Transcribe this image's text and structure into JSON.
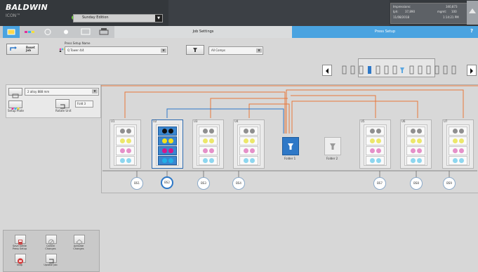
{
  "top": {
    "brand": "BALDWIN",
    "brand_sub": "ICON™",
    "edition": "Sunday Edition",
    "stats": {
      "impressions_label": "Impressions:",
      "impressions_value": "340,873",
      "iph_label": "Iph:",
      "iph_value": "37,890",
      "mgmt_label": "mgmt:",
      "mgmt_value": "100",
      "date": "11/08/2018",
      "time": "1:14:21 PM"
    }
  },
  "tabs": {
    "job_settings": "Job Settings",
    "press_setup": "Press Setup",
    "help": "?"
  },
  "controls": {
    "reset_job": "Reset Job",
    "press_setup_name_label": "Press Setup Name",
    "press_setup_name": "Q Tower 4/4",
    "all_comps": "All Comps"
  },
  "left_panel": {
    "dropdown_value": "2 alloy 888 mm",
    "setup_plate_label": "Setup Plate",
    "rotate_unit_label": "Rotate Unit",
    "rotate_value": "Fold 3"
  },
  "units": [
    {
      "label": "U1",
      "node": "BS1"
    },
    {
      "label": "U2",
      "node": "BS2"
    },
    {
      "label": "U3",
      "node": "BS3"
    },
    {
      "label": "U4",
      "node": "BS4"
    },
    {
      "label": "U5",
      "node": "BS7"
    },
    {
      "label": "U6",
      "node": "BS8"
    },
    {
      "label": "U7",
      "node": "BS9"
    }
  ],
  "folders": {
    "folder1": "Folder 1",
    "folder2": "Folder 2"
  },
  "bottom": {
    "save_button": "Save Settle Press Setup",
    "cancel_button": "Cancel Changes",
    "activate_button": "Activate Changes",
    "stop_button": "Stop",
    "update_button": "Update Job"
  },
  "colors": {
    "accent": "#4aa3e0",
    "header": "#34383c",
    "web_line": "#e8773a",
    "selected": "#2e78c7"
  }
}
